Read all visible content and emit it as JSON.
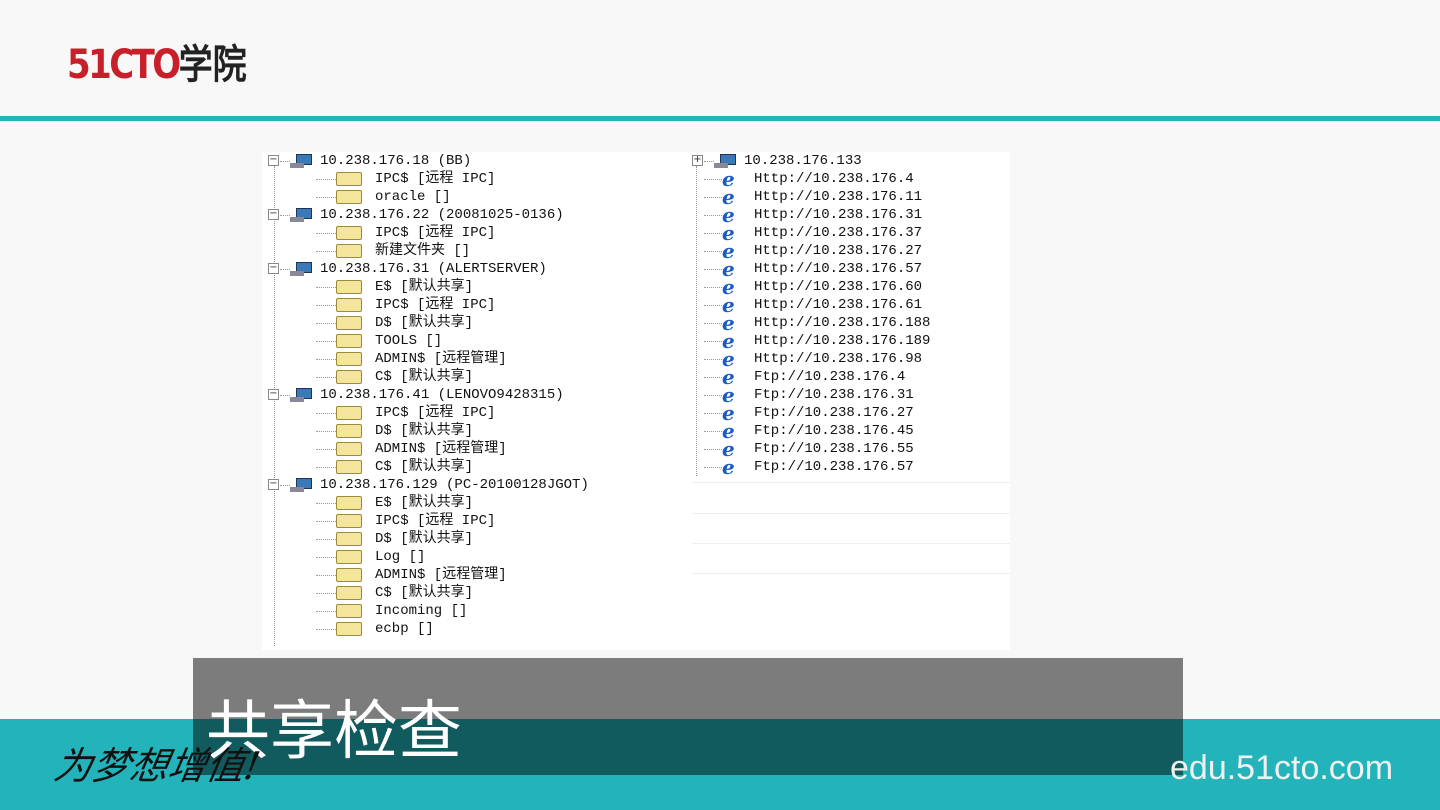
{
  "brand": {
    "logo_red": "51CTO",
    "logo_black": "学院",
    "accent": "#22b4ba",
    "logo_color": "#c8202a"
  },
  "tree_left": [
    {
      "type": "host",
      "text": "10.238.176.18  (BB)"
    },
    {
      "type": "share",
      "text": "IPC$ [远程 IPC]"
    },
    {
      "type": "share",
      "text": "oracle []"
    },
    {
      "type": "host",
      "text": "10.238.176.22  (20081025-0136)"
    },
    {
      "type": "share",
      "text": "IPC$ [远程 IPC]"
    },
    {
      "type": "share",
      "text": "新建文件夹 []"
    },
    {
      "type": "host",
      "text": "10.238.176.31  (ALERTSERVER)"
    },
    {
      "type": "share",
      "text": "E$ [默认共享]"
    },
    {
      "type": "share",
      "text": "IPC$ [远程 IPC]"
    },
    {
      "type": "share",
      "text": "D$ [默认共享]"
    },
    {
      "type": "share",
      "text": "TOOLS []"
    },
    {
      "type": "share",
      "text": "ADMIN$ [远程管理]"
    },
    {
      "type": "share",
      "text": "C$ [默认共享]"
    },
    {
      "type": "host",
      "text": "10.238.176.41  (LENOVO9428315)"
    },
    {
      "type": "share",
      "text": "IPC$ [远程 IPC]"
    },
    {
      "type": "share",
      "text": "D$ [默认共享]"
    },
    {
      "type": "share",
      "text": "ADMIN$ [远程管理]"
    },
    {
      "type": "share",
      "text": "C$ [默认共享]"
    },
    {
      "type": "host",
      "text": "10.238.176.129 (PC-20100128JGOT)"
    },
    {
      "type": "share",
      "text": "E$ [默认共享]"
    },
    {
      "type": "share",
      "text": "IPC$ [远程 IPC]"
    },
    {
      "type": "share",
      "text": "D$ [默认共享]"
    },
    {
      "type": "share",
      "text": "Log []"
    },
    {
      "type": "share",
      "text": "ADMIN$ [远程管理]"
    },
    {
      "type": "share",
      "text": "C$ [默认共享]"
    },
    {
      "type": "share",
      "text": "Incoming []"
    },
    {
      "type": "share",
      "text": "ecbp []"
    }
  ],
  "tree_right": [
    {
      "type": "host",
      "text": "10.238.176.133"
    },
    {
      "type": "link",
      "text": "Http://10.238.176.4"
    },
    {
      "type": "link",
      "text": "Http://10.238.176.11"
    },
    {
      "type": "link",
      "text": "Http://10.238.176.31"
    },
    {
      "type": "link",
      "text": "Http://10.238.176.37"
    },
    {
      "type": "link",
      "text": "Http://10.238.176.27"
    },
    {
      "type": "link",
      "text": "Http://10.238.176.57"
    },
    {
      "type": "link",
      "text": "Http://10.238.176.60"
    },
    {
      "type": "link",
      "text": "Http://10.238.176.61"
    },
    {
      "type": "link",
      "text": "Http://10.238.176.188"
    },
    {
      "type": "link",
      "text": "Http://10.238.176.189"
    },
    {
      "type": "link",
      "text": "Http://10.238.176.98"
    },
    {
      "type": "link",
      "text": "Ftp://10.238.176.4"
    },
    {
      "type": "link",
      "text": "Ftp://10.238.176.31"
    },
    {
      "type": "link",
      "text": "Ftp://10.238.176.27"
    },
    {
      "type": "link",
      "text": "Ftp://10.238.176.45"
    },
    {
      "type": "link",
      "text": "Ftp://10.238.176.55"
    },
    {
      "type": "link",
      "text": "Ftp://10.238.176.57"
    }
  ],
  "caption": "共享检查",
  "slogan": "为梦想增值!",
  "site": "edu.51cto.com"
}
